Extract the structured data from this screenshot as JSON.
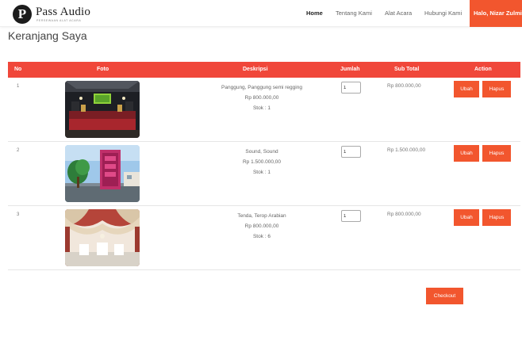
{
  "brand": {
    "logo_letter": "P",
    "name": "Pass Audio",
    "tagline": "PERSEWAAN ALAT ACARA"
  },
  "nav": {
    "links": [
      "Home",
      "Tentang Kami",
      "Alat Acara",
      "Hubungi Kami"
    ],
    "user_label": "Halo, Nizar Zulmi"
  },
  "page": {
    "title": "Keranjang Saya"
  },
  "table": {
    "headers": {
      "no": "No",
      "foto": "Foto",
      "deskripsi": "Deskripsi",
      "jumlah": "Jumlah",
      "subtotal": "Sub Total",
      "action": "Action"
    },
    "rows": [
      {
        "no": "1",
        "photo_alt": "stage-photo",
        "title": "Panggung, Panggung semi regging",
        "price": "Rp 800.000,00",
        "stock": "Stok : 1",
        "qty": "1",
        "subtotal": "Rp 800.000,00",
        "edit": "Ubah",
        "delete": "Hapus"
      },
      {
        "no": "2",
        "photo_alt": "sound-system-photo",
        "title": "Sound, Sound",
        "price": "Rp 1.500.000,00",
        "stock": "Stok : 1",
        "qty": "1",
        "subtotal": "Rp 1.500.000,00",
        "edit": "Ubah",
        "delete": "Hapus"
      },
      {
        "no": "3",
        "photo_alt": "tent-decoration-photo",
        "title": "Tenda, Terop Arabian",
        "price": "Rp 800.000,00",
        "stock": "Stok : 6",
        "qty": "1",
        "subtotal": "Rp 800.000,00",
        "edit": "Ubah",
        "delete": "Hapus"
      }
    ]
  },
  "checkout_label": "Checkout",
  "colors": {
    "accent": "#f2562e",
    "header": "#f0473a"
  }
}
